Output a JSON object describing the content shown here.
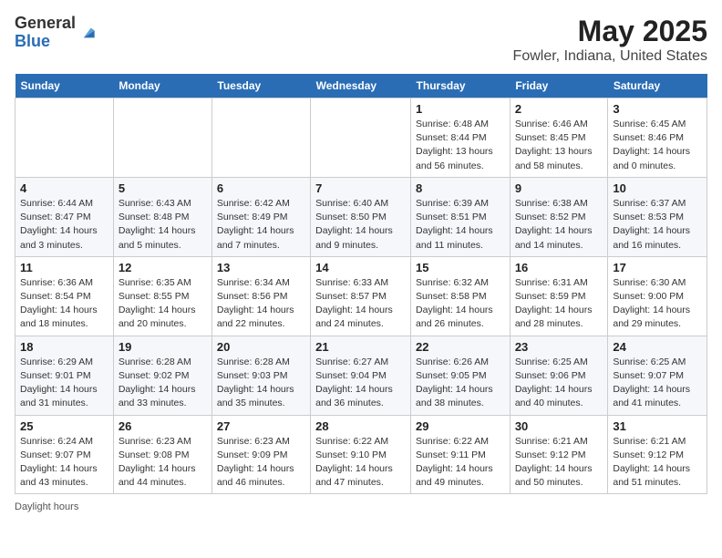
{
  "header": {
    "logo_line1": "General",
    "logo_line2": "Blue",
    "title": "May 2025",
    "subtitle": "Fowler, Indiana, United States"
  },
  "days_of_week": [
    "Sunday",
    "Monday",
    "Tuesday",
    "Wednesday",
    "Thursday",
    "Friday",
    "Saturday"
  ],
  "weeks": [
    [
      {
        "day": "",
        "info": ""
      },
      {
        "day": "",
        "info": ""
      },
      {
        "day": "",
        "info": ""
      },
      {
        "day": "",
        "info": ""
      },
      {
        "day": "1",
        "info": "Sunrise: 6:48 AM\nSunset: 8:44 PM\nDaylight: 13 hours and 56 minutes."
      },
      {
        "day": "2",
        "info": "Sunrise: 6:46 AM\nSunset: 8:45 PM\nDaylight: 13 hours and 58 minutes."
      },
      {
        "day": "3",
        "info": "Sunrise: 6:45 AM\nSunset: 8:46 PM\nDaylight: 14 hours and 0 minutes."
      }
    ],
    [
      {
        "day": "4",
        "info": "Sunrise: 6:44 AM\nSunset: 8:47 PM\nDaylight: 14 hours and 3 minutes."
      },
      {
        "day": "5",
        "info": "Sunrise: 6:43 AM\nSunset: 8:48 PM\nDaylight: 14 hours and 5 minutes."
      },
      {
        "day": "6",
        "info": "Sunrise: 6:42 AM\nSunset: 8:49 PM\nDaylight: 14 hours and 7 minutes."
      },
      {
        "day": "7",
        "info": "Sunrise: 6:40 AM\nSunset: 8:50 PM\nDaylight: 14 hours and 9 minutes."
      },
      {
        "day": "8",
        "info": "Sunrise: 6:39 AM\nSunset: 8:51 PM\nDaylight: 14 hours and 11 minutes."
      },
      {
        "day": "9",
        "info": "Sunrise: 6:38 AM\nSunset: 8:52 PM\nDaylight: 14 hours and 14 minutes."
      },
      {
        "day": "10",
        "info": "Sunrise: 6:37 AM\nSunset: 8:53 PM\nDaylight: 14 hours and 16 minutes."
      }
    ],
    [
      {
        "day": "11",
        "info": "Sunrise: 6:36 AM\nSunset: 8:54 PM\nDaylight: 14 hours and 18 minutes."
      },
      {
        "day": "12",
        "info": "Sunrise: 6:35 AM\nSunset: 8:55 PM\nDaylight: 14 hours and 20 minutes."
      },
      {
        "day": "13",
        "info": "Sunrise: 6:34 AM\nSunset: 8:56 PM\nDaylight: 14 hours and 22 minutes."
      },
      {
        "day": "14",
        "info": "Sunrise: 6:33 AM\nSunset: 8:57 PM\nDaylight: 14 hours and 24 minutes."
      },
      {
        "day": "15",
        "info": "Sunrise: 6:32 AM\nSunset: 8:58 PM\nDaylight: 14 hours and 26 minutes."
      },
      {
        "day": "16",
        "info": "Sunrise: 6:31 AM\nSunset: 8:59 PM\nDaylight: 14 hours and 28 minutes."
      },
      {
        "day": "17",
        "info": "Sunrise: 6:30 AM\nSunset: 9:00 PM\nDaylight: 14 hours and 29 minutes."
      }
    ],
    [
      {
        "day": "18",
        "info": "Sunrise: 6:29 AM\nSunset: 9:01 PM\nDaylight: 14 hours and 31 minutes."
      },
      {
        "day": "19",
        "info": "Sunrise: 6:28 AM\nSunset: 9:02 PM\nDaylight: 14 hours and 33 minutes."
      },
      {
        "day": "20",
        "info": "Sunrise: 6:28 AM\nSunset: 9:03 PM\nDaylight: 14 hours and 35 minutes."
      },
      {
        "day": "21",
        "info": "Sunrise: 6:27 AM\nSunset: 9:04 PM\nDaylight: 14 hours and 36 minutes."
      },
      {
        "day": "22",
        "info": "Sunrise: 6:26 AM\nSunset: 9:05 PM\nDaylight: 14 hours and 38 minutes."
      },
      {
        "day": "23",
        "info": "Sunrise: 6:25 AM\nSunset: 9:06 PM\nDaylight: 14 hours and 40 minutes."
      },
      {
        "day": "24",
        "info": "Sunrise: 6:25 AM\nSunset: 9:07 PM\nDaylight: 14 hours and 41 minutes."
      }
    ],
    [
      {
        "day": "25",
        "info": "Sunrise: 6:24 AM\nSunset: 9:07 PM\nDaylight: 14 hours and 43 minutes."
      },
      {
        "day": "26",
        "info": "Sunrise: 6:23 AM\nSunset: 9:08 PM\nDaylight: 14 hours and 44 minutes."
      },
      {
        "day": "27",
        "info": "Sunrise: 6:23 AM\nSunset: 9:09 PM\nDaylight: 14 hours and 46 minutes."
      },
      {
        "day": "28",
        "info": "Sunrise: 6:22 AM\nSunset: 9:10 PM\nDaylight: 14 hours and 47 minutes."
      },
      {
        "day": "29",
        "info": "Sunrise: 6:22 AM\nSunset: 9:11 PM\nDaylight: 14 hours and 49 minutes."
      },
      {
        "day": "30",
        "info": "Sunrise: 6:21 AM\nSunset: 9:12 PM\nDaylight: 14 hours and 50 minutes."
      },
      {
        "day": "31",
        "info": "Sunrise: 6:21 AM\nSunset: 9:12 PM\nDaylight: 14 hours and 51 minutes."
      }
    ]
  ],
  "footer": "Daylight hours"
}
